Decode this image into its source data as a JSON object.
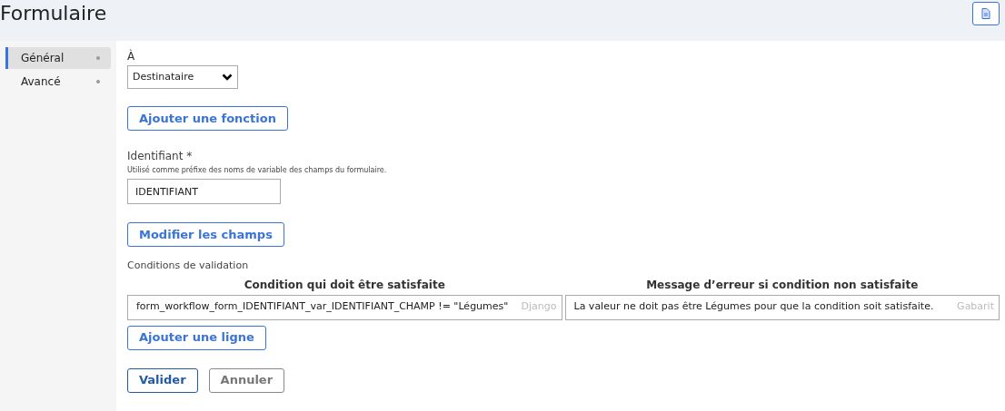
{
  "header": {
    "title": "Formulaire"
  },
  "sidebar": {
    "items": [
      {
        "label": "Général",
        "selected": true
      },
      {
        "label": "Avancé",
        "selected": false
      }
    ]
  },
  "form": {
    "to": {
      "label": "À",
      "value": "Destinataire"
    },
    "add_function_button": "Ajouter une fonction",
    "identifier": {
      "label": "Identifiant *",
      "hint": "Utilisé comme préfixe des noms de variable des champs du formulaire.",
      "value": "IDENTIFIANT"
    },
    "edit_fields_button": "Modifier les champs",
    "validation": {
      "label": "Conditions de validation",
      "columns": [
        "Condition qui doit être satisfaite",
        "Message d’erreur si condition non satisfaite"
      ],
      "rows": [
        {
          "condition": "form_workflow_form_IDENTIFIANT_var_IDENTIFIANT_CHAMP != \"Légumes\"",
          "condition_type": "Django",
          "message": "La valeur ne doit pas être Légumes pour que la condition soit satisfaite.",
          "message_type": "Gabarit"
        }
      ],
      "add_row_button": "Ajouter une ligne"
    },
    "submit_button": "Valider",
    "cancel_button": "Annuler"
  }
}
